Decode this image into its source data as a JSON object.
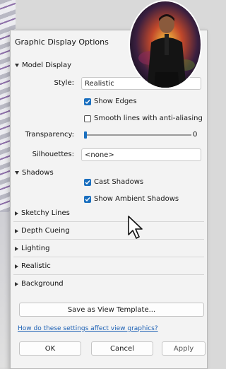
{
  "dialog": {
    "title": "Graphic Display Options",
    "model_display": {
      "header": "Model Display",
      "style_label": "Style:",
      "style_value": "Realistic",
      "show_edges": {
        "label": "Show Edges",
        "checked": true
      },
      "smooth_lines": {
        "label": "Smooth lines with anti-aliasing",
        "checked": false
      },
      "transparency_label": "Transparency:",
      "transparency_value": "0",
      "transparency_level": 0,
      "silhouettes_label": "Silhouettes:",
      "silhouettes_value": "<none>"
    },
    "shadows": {
      "header": "Shadows",
      "cast_shadows": {
        "label": "Cast Shadows",
        "checked": true
      },
      "ambient_shadows": {
        "label": "Show Ambient Shadows",
        "checked": true
      }
    },
    "collapsed_sections": [
      "Sketchy Lines",
      "Depth Cueing",
      "Lighting",
      "Realistic",
      "Background"
    ],
    "save_template_label": "Save as View Template...",
    "help_link": "How do these settings affect view graphics?",
    "buttons": {
      "ok": "OK",
      "cancel": "Cancel",
      "apply": "Apply"
    }
  },
  "icons": {
    "expanded": "chevron-down-icon",
    "collapsed": "chevron-right-icon",
    "cursor": "mouse-pointer-icon",
    "avatar": "presenter-avatar"
  },
  "colors": {
    "accent": "#1a6fbf",
    "link": "#1a5fb4",
    "dialog_bg": "#f3f3f3"
  }
}
